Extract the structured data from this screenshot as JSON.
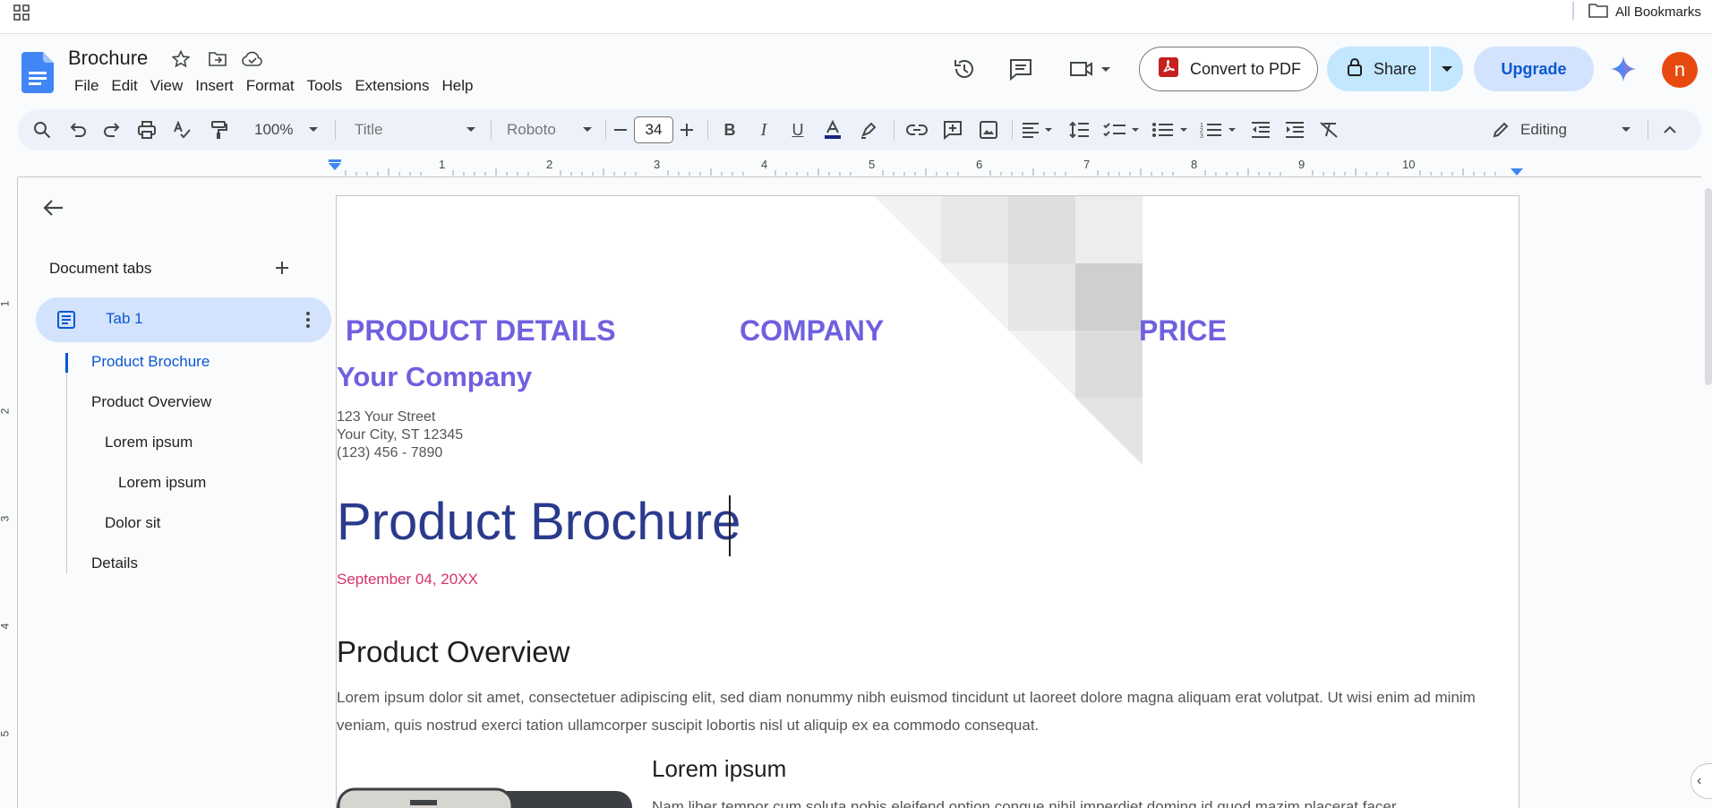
{
  "bookmarks_bar": {
    "all_bookmarks_label": "All Bookmarks"
  },
  "document": {
    "title": "Brochure"
  },
  "menu": [
    "File",
    "Edit",
    "View",
    "Insert",
    "Format",
    "Tools",
    "Extensions",
    "Help"
  ],
  "header_actions": {
    "convert_label": "Convert to PDF",
    "share_label": "Share",
    "upgrade_label": "Upgrade",
    "avatar_initial": "n"
  },
  "toolbar": {
    "zoom": "100%",
    "style": "Title",
    "font": "Roboto",
    "font_size": "34",
    "mode": "Editing"
  },
  "ruler": {
    "numbers": [
      "1",
      "2",
      "3",
      "4",
      "5",
      "6",
      "7",
      "8",
      "9",
      "10"
    ],
    "vertical_numbers": [
      "1",
      "2",
      "3",
      "4",
      "5"
    ]
  },
  "sidebar": {
    "title": "Document tabs",
    "tab_label": "Tab 1",
    "outline": [
      {
        "label": "Product Brochure",
        "level": 1,
        "active": true
      },
      {
        "label": "Product Overview",
        "level": 1
      },
      {
        "label": "Lorem ipsum",
        "level": 2
      },
      {
        "label": "Lorem ipsum",
        "level": 3
      },
      {
        "label": "Dolor sit",
        "level": 2
      },
      {
        "label": "Details",
        "level": 1
      }
    ]
  },
  "page": {
    "col_product": "PRODUCT DETAILS",
    "col_company": "COMPANY",
    "col_price": "PRICE",
    "company_name": "Your Company",
    "address": [
      "123 Your Street",
      "Your City, ST 12345",
      "(123) 456 - 7890"
    ],
    "title": "Product Brochure",
    "date": "September 04, 20XX",
    "overview_heading": "Product Overview",
    "overview_body": "Lorem ipsum dolor sit amet, consectetuer adipiscing elit, sed diam nonummy nibh euismod tincidunt ut laoreet dolore magna aliquam erat volutpat. Ut wisi enim ad minim veniam, quis nostrud exerci tation ullamcorper suscipit lobortis nisl ut aliquip ex ea commodo consequat.",
    "sub_heading": "Lorem ipsum",
    "sub_body": "Nam liber tempor cum soluta nobis eleifend option congue nihil imperdiet doming id quod mazim placerat facer"
  },
  "colors": {
    "accent": "#7060df",
    "title": "#2a3a8c",
    "date": "#d6336c",
    "share": "#c2e7ff",
    "avatar": "#e8490f"
  }
}
